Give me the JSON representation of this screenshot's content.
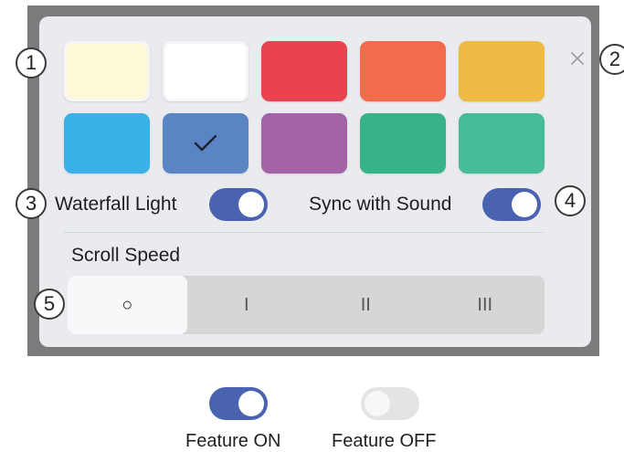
{
  "colors": {
    "frame": "#7b7b7b",
    "panel": "#e9ebef",
    "toggle_on": "#4a63b0",
    "toggle_off": "#e4e4e4"
  },
  "swatches": [
    {
      "name": "pale-yellow",
      "color": "#fdf8d8",
      "selected": false
    },
    {
      "name": "white",
      "color": "#ffffff",
      "selected": false
    },
    {
      "name": "red",
      "color": "#e8434f",
      "selected": false
    },
    {
      "name": "orange",
      "color": "#f26b4b",
      "selected": false
    },
    {
      "name": "yellow",
      "color": "#f0b944",
      "selected": false
    },
    {
      "name": "sky-blue",
      "color": "#3ab2e8",
      "selected": false
    },
    {
      "name": "steel-blue",
      "color": "#5b84c4",
      "selected": true,
      "icon": "checkmark-icon"
    },
    {
      "name": "purple",
      "color": "#a462a7",
      "selected": false
    },
    {
      "name": "green",
      "color": "#36b487",
      "selected": false
    },
    {
      "name": "teal-green",
      "color": "#46bc9a",
      "selected": false
    }
  ],
  "close_icon": "close-icon",
  "callouts": [
    "1",
    "2",
    "3",
    "4",
    "5"
  ],
  "waterfall": {
    "label": "Waterfall Light",
    "state": "on"
  },
  "sync": {
    "label": "Sync with Sound",
    "state": "on"
  },
  "scroll_speed": {
    "label": "Scroll Speed",
    "options": [
      "○",
      "I",
      "II",
      "III"
    ],
    "selected_index": 0
  },
  "legend": {
    "on_label": "Feature ON",
    "off_label": "Feature OFF"
  }
}
